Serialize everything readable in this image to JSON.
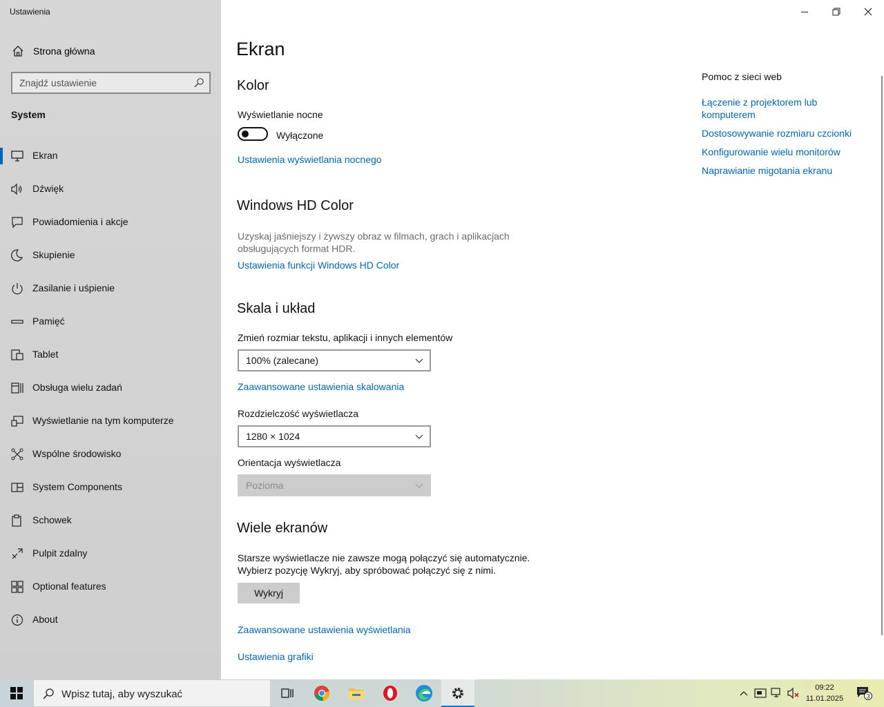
{
  "window": {
    "title": "Ustawienia"
  },
  "sidebar": {
    "home_label": "Strona główna",
    "search_placeholder": "Znajdź ustawienie",
    "section_title": "System",
    "items": [
      {
        "label": "Ekran",
        "icon": "monitor-icon",
        "active": true
      },
      {
        "label": "Dźwięk",
        "icon": "speaker-icon"
      },
      {
        "label": "Powiadomienia i akcje",
        "icon": "notification-icon"
      },
      {
        "label": "Skupienie",
        "icon": "moon-icon"
      },
      {
        "label": "Zasilanie i uśpienie",
        "icon": "power-icon"
      },
      {
        "label": "Pamięć",
        "icon": "storage-icon"
      },
      {
        "label": "Tablet",
        "icon": "tablet-icon"
      },
      {
        "label": "Obsługa wielu zadań",
        "icon": "multitasking-icon"
      },
      {
        "label": "Wyświetlanie na tym komputerze",
        "icon": "projecting-icon"
      },
      {
        "label": "Wspólne środowisko",
        "icon": "shared-experiences-icon"
      },
      {
        "label": "System Components",
        "icon": "components-icon"
      },
      {
        "label": "Schowek",
        "icon": "clipboard-icon"
      },
      {
        "label": "Pulpit zdalny",
        "icon": "remote-desktop-icon"
      },
      {
        "label": "Optional features",
        "icon": "optional-features-icon"
      },
      {
        "label": "About",
        "icon": "info-icon"
      }
    ]
  },
  "main": {
    "title": "Ekran",
    "color": {
      "heading": "Kolor",
      "night_light_label": "Wyświetlanie nocne",
      "night_light_state": "Wyłączone",
      "night_light_link": "Ustawienia wyświetlania nocnego"
    },
    "hd_color": {
      "heading": "Windows HD Color",
      "description": "Uzyskaj jaśniejszy i żywszy obraz w filmach, grach i aplikacjach obsługujących format HDR.",
      "link": "Ustawienia funkcji Windows HD Color"
    },
    "scale": {
      "heading": "Skala i układ",
      "scale_label": "Zmień rozmiar tekstu, aplikacji i innych elementów",
      "scale_value": "100% (zalecane)",
      "advanced_scaling_link": "Zaawansowane ustawienia skalowania",
      "resolution_label": "Rozdzielczość wyświetlacza",
      "resolution_value": "1280 × 1024",
      "orientation_label": "Orientacja wyświetlacza",
      "orientation_value": "Pozioma"
    },
    "multi": {
      "heading": "Wiele ekranów",
      "description_line1": "Starsze wyświetlacze nie zawsze mogą połączyć się automatycznie.",
      "description_line2": "Wybierz pozycję Wykryj, aby spróbować połączyć się z nimi.",
      "detect_button": "Wykryj",
      "advanced_display_link": "Zaawansowane ustawienia wyświetlania",
      "graphics_link": "Ustawienia grafiki"
    }
  },
  "help": {
    "title": "Pomoc z sieci web",
    "links": [
      "Łączenie z projektorem lub komputerem",
      "Dostosowywanie rozmiaru czcionki",
      "Konfigurowanie wielu monitorów",
      "Naprawianie migotania ekranu"
    ]
  },
  "taskbar": {
    "search_placeholder": "Wpisz tutaj, aby wyszukać",
    "apps": [
      "task-view-icon",
      "chrome-icon",
      "file-explorer-icon",
      "opera-icon",
      "edge-icon",
      "settings-icon"
    ],
    "time": "09:22",
    "date": "11.01.2025",
    "notification_count": "3"
  },
  "colors": {
    "accent": "#0067b8",
    "active_bar": "#0063b1",
    "sidebar_bg": "#d2d2d2"
  }
}
